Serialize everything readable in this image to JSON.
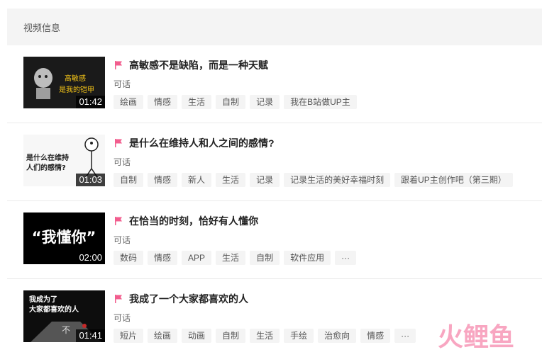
{
  "header": {
    "title": "视频信息"
  },
  "videos": [
    {
      "title": "高敏感不是缺陷，而是一种天赋",
      "uploader": "可话",
      "duration": "01:42",
      "thumb_text": [
        "高敏感",
        "是我的铠甲"
      ],
      "tags": [
        "绘画",
        "情感",
        "生活",
        "自制",
        "记录",
        "我在B站做UP主"
      ]
    },
    {
      "title": "是什么在维持人和人之间的感情?",
      "uploader": "可话",
      "duration": "01:03",
      "thumb_text": [
        "是什么在维持",
        "人们的感情?"
      ],
      "tags": [
        "自制",
        "情感",
        "新人",
        "生活",
        "记录",
        "记录生活的美好幸福时刻",
        "跟着UP主创作吧（第三期）"
      ]
    },
    {
      "title": "在恰当的时刻，恰好有人懂你",
      "uploader": "可话",
      "duration": "02:00",
      "thumb_text": [
        "“我懂你”"
      ],
      "tags": [
        "数码",
        "情感",
        "APP",
        "生活",
        "自制",
        "软件应用",
        "···"
      ]
    },
    {
      "title": "我成了一个大家都喜欢的人",
      "uploader": "可话",
      "duration": "01:41",
      "thumb_text": [
        "我成为了",
        "大家都喜欢的人",
        "不"
      ],
      "tags": [
        "短片",
        "绘画",
        "动画",
        "自制",
        "生活",
        "手绘",
        "治愈向",
        "情感",
        "···"
      ]
    }
  ],
  "watermark": {
    "text": "火鲤鱼"
  },
  "colors": {
    "flag": "#f25d8e",
    "tag_bg": "#f4f4f4",
    "header_bg": "#f4f4f4"
  }
}
